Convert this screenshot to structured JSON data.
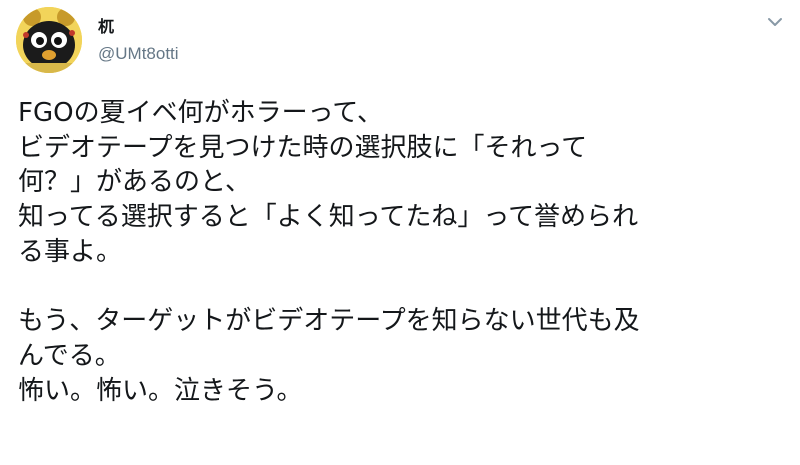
{
  "tweet": {
    "author": {
      "display_name": "杌",
      "handle": "@UMt8otti",
      "avatar_icon": "mascot-avatar-icon"
    },
    "menu_icon": "chevron-down-icon",
    "paragraphs": [
      [
        "FGOの夏イベ何がホラーって、",
        "ビデオテープを見つけた時の選択肢に「それって",
        "何？」があるのと、",
        "知ってる選択すると「よく知ってたね」って誉められ",
        "る事よ。"
      ],
      [
        "もう、ターゲットがビデオテープを知らない世代も及",
        "んでる。",
        "怖い。怖い。泣きそう。"
      ]
    ]
  },
  "colors": {
    "text": "#14171a",
    "secondary_text": "#657786",
    "avatar_bg": "#f2d45a"
  }
}
